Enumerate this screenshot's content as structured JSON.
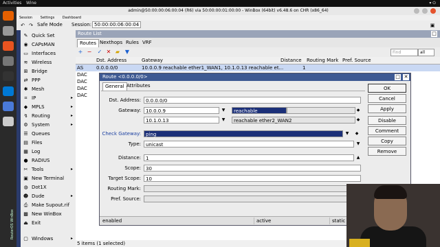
{
  "topbar": {
    "activities": "Activities",
    "app": "Wine",
    "title": "admin@50:00:00:06:00:04 (R6) via 50:00:00:01:00:00 - WinBox (64bit) v6.48.6 on CHR (x86_64)",
    "tray": "▾ ⏻"
  },
  "menubar": {
    "items": [
      "Session",
      "Settings",
      "Dashboard"
    ]
  },
  "toolbar": {
    "safe_mode": "Safe Mode",
    "session_label": "Session:",
    "session_value": "50:00:00:06:00:04"
  },
  "sidebar": {
    "vertical_text": "RouterOS WinBox",
    "items": [
      {
        "label": "Quick Set",
        "arrow": ""
      },
      {
        "label": "CAPsMAN",
        "arrow": ""
      },
      {
        "label": "Interfaces",
        "arrow": ""
      },
      {
        "label": "Wireless",
        "arrow": ""
      },
      {
        "label": "Bridge",
        "arrow": ""
      },
      {
        "label": "PPP",
        "arrow": ""
      },
      {
        "label": "Mesh",
        "arrow": ""
      },
      {
        "label": "IP",
        "arrow": "▸"
      },
      {
        "label": "MPLS",
        "arrow": "▸"
      },
      {
        "label": "Routing",
        "arrow": "▸"
      },
      {
        "label": "System",
        "arrow": "▸"
      },
      {
        "label": "Queues",
        "arrow": ""
      },
      {
        "label": "Files",
        "arrow": ""
      },
      {
        "label": "Log",
        "arrow": ""
      },
      {
        "label": "RADIUS",
        "arrow": ""
      },
      {
        "label": "Tools",
        "arrow": "▸"
      },
      {
        "label": "New Terminal",
        "arrow": ""
      },
      {
        "label": "Dot1X",
        "arrow": ""
      },
      {
        "label": "Dude",
        "arrow": "▸"
      },
      {
        "label": "Make Supout.rif",
        "arrow": ""
      },
      {
        "label": "New WinBox",
        "arrow": ""
      },
      {
        "label": "Exit",
        "arrow": ""
      },
      {
        "label": "Windows",
        "arrow": "▸"
      }
    ]
  },
  "route_list": {
    "title": "Route List",
    "tabs": [
      "Routes",
      "Nexthops",
      "Rules",
      "VRF"
    ],
    "find_placeholder": "Find",
    "filter": "all",
    "columns": [
      "Dst. Address",
      "Gateway",
      "Distance",
      "Routing Mark",
      "Pref. Source"
    ],
    "rows": [
      {
        "flag": "AS",
        "dst": "0.0.0.0/0",
        "gateway": "10.0.0.9 reachable ether1_WAN1, 10.1.0.13 reachable et...",
        "distance": "1",
        "mark": "",
        "pref": ""
      },
      {
        "flag": "DAC",
        "dst": "",
        "gateway": "",
        "distance": "",
        "mark": "",
        "pref": ""
      },
      {
        "flag": "DAC",
        "dst": "",
        "gateway": "",
        "distance": "",
        "mark": "",
        "pref": ""
      },
      {
        "flag": "DAC",
        "dst": "",
        "gateway": "",
        "distance": "",
        "mark": "",
        "pref": ""
      },
      {
        "flag": "DAC",
        "dst": "",
        "gateway": "",
        "distance": "",
        "mark": "",
        "pref": ""
      }
    ],
    "status": "5 items (1 selected)"
  },
  "dialog": {
    "title": "Route <0.0.0.0/0>",
    "tabs": [
      "General",
      "Attributes"
    ],
    "fields": {
      "dst_label": "Dst. Address:",
      "dst": "0.0.0.0/0",
      "gateway_label": "Gateway:",
      "gw1": "10.0.0.9",
      "gw1_status": "reachable ether1_WAN",
      "gw2": "10.1.0.13",
      "gw2_status": "reachable ether2_WAN2",
      "check_label": "Check Gateway:",
      "check": "ping",
      "type_label": "Type:",
      "type": "unicast",
      "distance_label": "Distance:",
      "distance": "1",
      "scope_label": "Scope:",
      "scope": "30",
      "target_scope_label": "Target Scope:",
      "target_scope": "10",
      "routing_mark_label": "Routing Mark:",
      "routing_mark": "",
      "pref_source_label": "Pref. Source:",
      "pref_source": ""
    },
    "buttons": [
      "OK",
      "Cancel",
      "Apply",
      "Disable",
      "Comment",
      "Copy",
      "Remove"
    ],
    "status": [
      "enabled",
      "active",
      "static"
    ]
  }
}
